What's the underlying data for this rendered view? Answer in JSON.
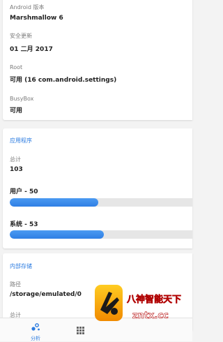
{
  "device": {
    "items": [
      {
        "label": "Android 版本",
        "value": "Marshmallow 6"
      },
      {
        "label": "安全更新",
        "value": "01 二月 2017"
      },
      {
        "label": "Root",
        "value": "可用 (16 com.android.settings)"
      },
      {
        "label": "BusyBox",
        "value": "可用"
      }
    ]
  },
  "apps": {
    "title": "应用程序",
    "total_label": "总计",
    "total_value": "103",
    "user_label": "用户 - 50",
    "user_fraction": 0.485,
    "system_label": "系统 - 53",
    "system_fraction": 0.515
  },
  "storage": {
    "title": "内部存储",
    "path_label": "路径",
    "path_value": "/storage/emulated/0",
    "total_label": "总计"
  },
  "bottom_nav": {
    "analyze_label": "分析",
    "analyze_icon": "analyze-icon",
    "grid_icon": "grid-icon"
  },
  "watermark": {
    "line1": "八神智能天下",
    "line2": "zntx.cc"
  },
  "colors": {
    "accent": "#2b7be0",
    "bar_fill": "#3a88ea",
    "track": "#e6e6e6"
  }
}
